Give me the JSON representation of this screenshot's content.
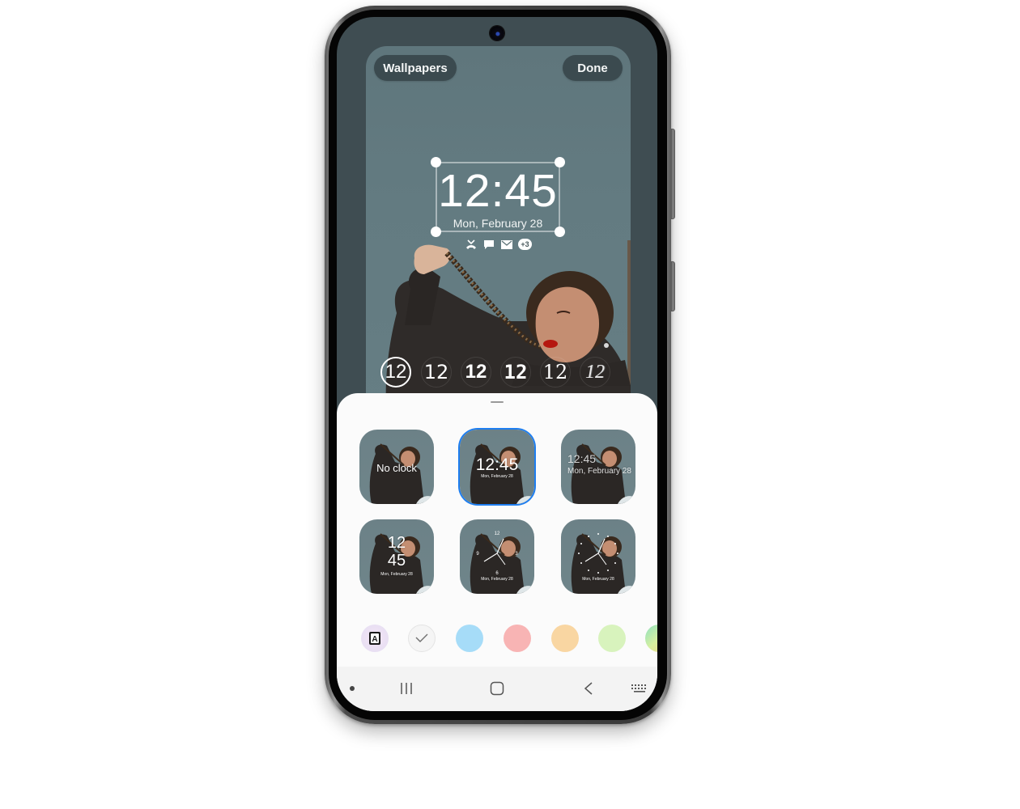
{
  "top_bar": {
    "wallpapers_label": "Wallpapers",
    "done_label": "Done"
  },
  "lock_clock": {
    "time": "12:45",
    "date": "Mon, February 28",
    "notification_icons": [
      "missed-call-icon",
      "message-icon",
      "email-icon"
    ],
    "more_count": "+3"
  },
  "clock_styles": {
    "selected_index": 0,
    "items": [
      {
        "label": "12",
        "style": "outlined-thin"
      },
      {
        "label": "12",
        "style": "regular"
      },
      {
        "label": "12",
        "style": "bold-sans"
      },
      {
        "label": "12",
        "style": "condensed-bold"
      },
      {
        "label": "12",
        "style": "serif"
      },
      {
        "label": "12",
        "style": "decorative"
      }
    ]
  },
  "layouts": {
    "selected_index": 1,
    "items": [
      {
        "name": "no-clock",
        "label": "No clock"
      },
      {
        "name": "centered-digital",
        "time": "12:45",
        "date": "Mon, February 28"
      },
      {
        "name": "left-digital",
        "time": "12:45",
        "date": "Mon, February 28"
      },
      {
        "name": "stacked-digital",
        "hours": "12",
        "minutes": "45",
        "date": "Mon, February 28"
      },
      {
        "name": "analog-numbers",
        "date": "Mon, February 28",
        "numbers": [
          "12",
          "3",
          "6",
          "9"
        ]
      },
      {
        "name": "analog-dots",
        "date": "Mon, February 28"
      }
    ]
  },
  "colors": {
    "items": [
      {
        "name": "auto-color",
        "icon": "A"
      },
      {
        "name": "default",
        "hex": "#f5f5f5",
        "selected": true
      },
      {
        "name": "blue",
        "hex": "#a6dcf8"
      },
      {
        "name": "red",
        "hex": "#f8b4b4"
      },
      {
        "name": "orange",
        "hex": "#f9d6a2"
      },
      {
        "name": "green",
        "hex": "#d8f3bd"
      },
      {
        "name": "gradient",
        "hex": "#9ee0b0"
      }
    ]
  },
  "navbar": {
    "items": [
      "dot",
      "recents",
      "home",
      "back",
      "keyboard"
    ]
  },
  "accent_color": "#1e7ef0"
}
